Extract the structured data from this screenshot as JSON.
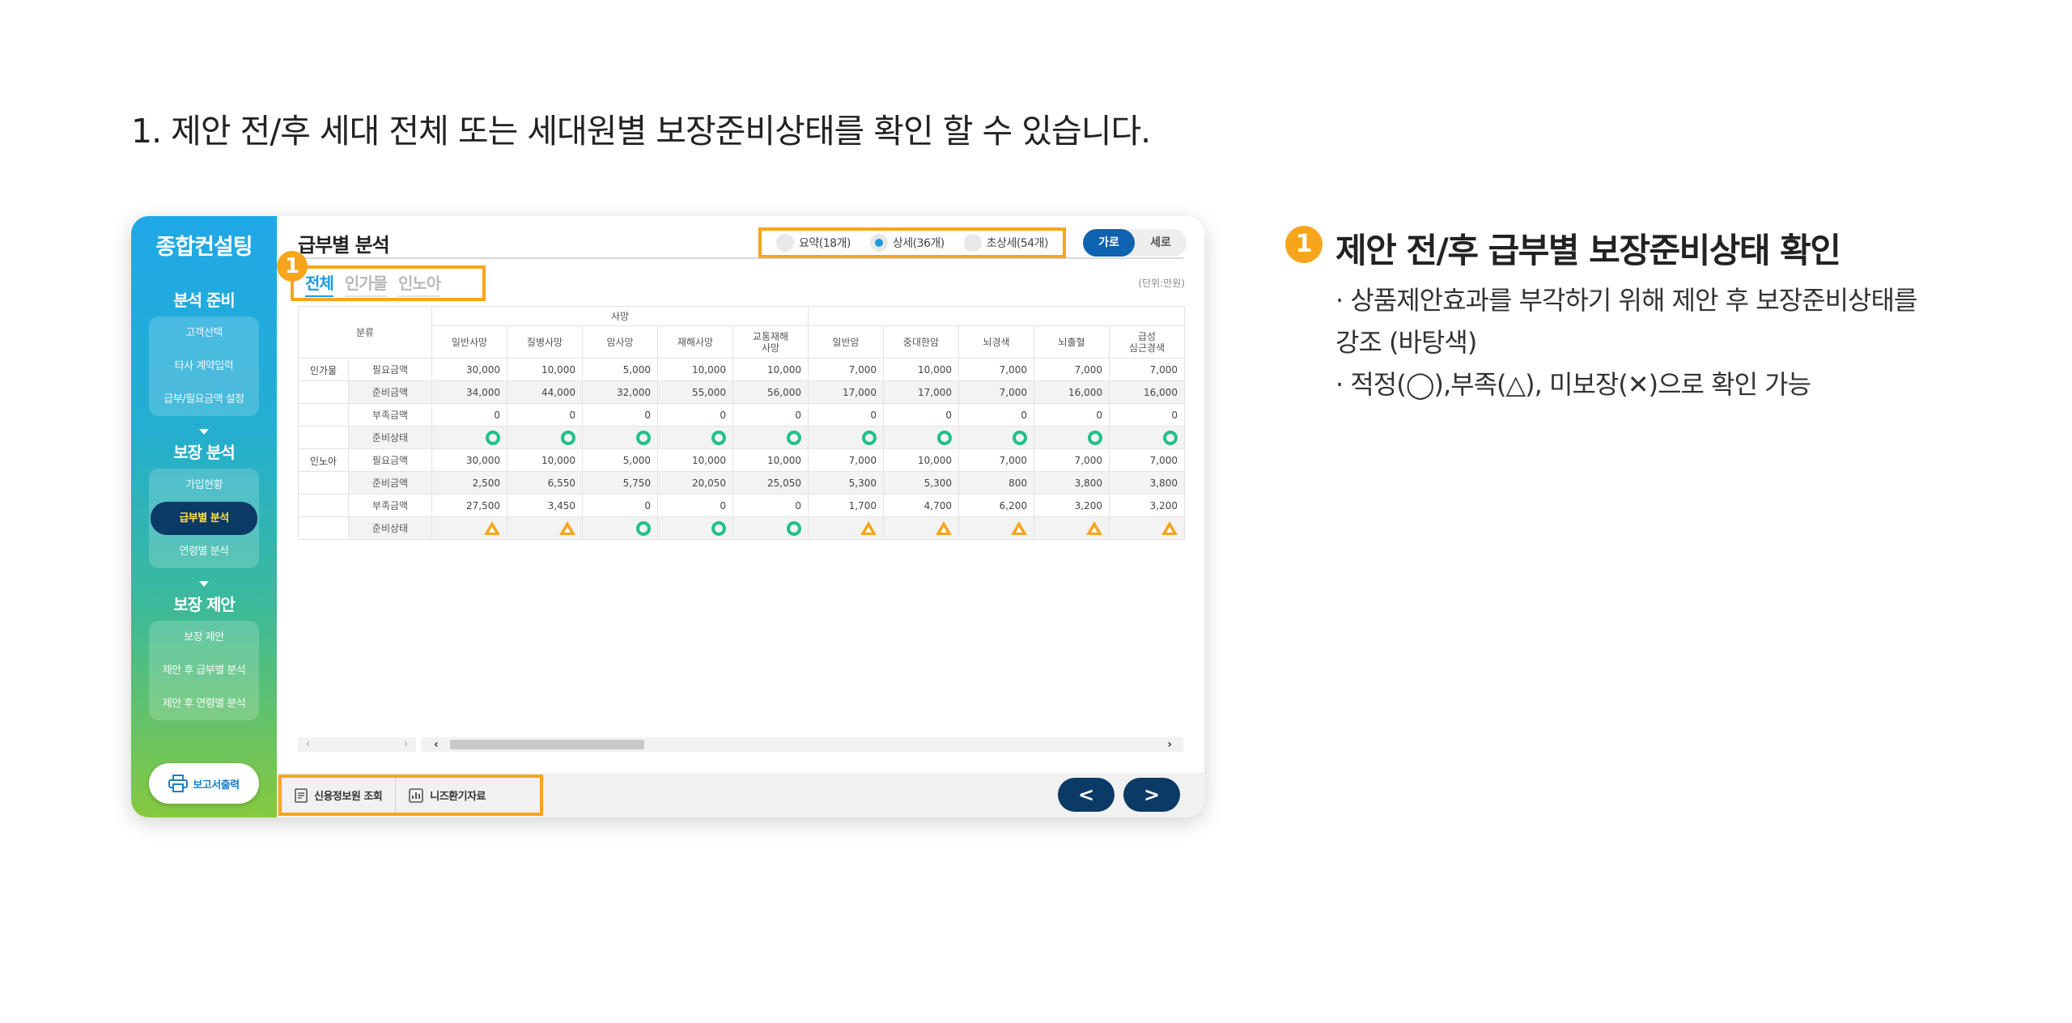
{
  "heading": "1. 제안 전/후  세대 전체 또는 세대원별 보장준비상태를 확인 할 수 있습니다.",
  "sidebar": {
    "brand": "종합컨설팅",
    "sections": [
      {
        "title": "분석 준비",
        "items": [
          "고객선택",
          "타사 계약입력",
          "급부/필요금액 설정"
        ]
      },
      {
        "title": "보장 분석",
        "items": [
          "가입현황",
          "급부별 분석",
          "연령별 분석"
        ],
        "active_index": 1
      },
      {
        "title": "보장 제안",
        "items": [
          "보장 제안",
          "제안 후 급부별 분석",
          "제안 후 연령별 분석"
        ]
      }
    ],
    "print_label": "보고서출력"
  },
  "content": {
    "title": "급부별 분석",
    "view_options": [
      {
        "label": "요약(18개)",
        "selected": false
      },
      {
        "label": "상세(36개)",
        "selected": true
      },
      {
        "label": "초상세(54개)",
        "selected": false
      }
    ],
    "orientation": [
      {
        "label": "가로",
        "selected": true
      },
      {
        "label": "세로",
        "selected": false
      }
    ],
    "tabs": [
      {
        "label": "전체",
        "selected": true
      },
      {
        "label": "인가물",
        "selected": false
      },
      {
        "label": "인노아",
        "selected": false
      }
    ],
    "badge_number": "1",
    "unit": "(단위:만원)"
  },
  "table": {
    "category_header": "분류",
    "group_header": "사망",
    "columns": [
      "일반사망",
      "질병사망",
      "암사망",
      "재해사망",
      "교통재해\n사망",
      "일반암",
      "중대한암",
      "뇌경색",
      "뇌출혈",
      "급성\n심근경색"
    ],
    "rows": [
      {
        "group": "인가물",
        "label": "필요금액",
        "values": [
          "30,000",
          "10,000",
          "5,000",
          "10,000",
          "10,000",
          "7,000",
          "10,000",
          "7,000",
          "7,000",
          "7,000"
        ]
      },
      {
        "group": "",
        "label": "준비금액",
        "values": [
          "34,000",
          "44,000",
          "32,000",
          "55,000",
          "56,000",
          "17,000",
          "17,000",
          "7,000",
          "16,000",
          "16,000"
        ]
      },
      {
        "group": "",
        "label": "부족금액",
        "values": [
          "0",
          "0",
          "0",
          "0",
          "0",
          "0",
          "0",
          "0",
          "0",
          "0"
        ]
      },
      {
        "group": "",
        "label": "준비상태",
        "status": [
          "ok",
          "ok",
          "ok",
          "ok",
          "ok",
          "ok",
          "ok",
          "ok",
          "ok",
          "ok"
        ]
      },
      {
        "group": "인노아",
        "label": "필요금액",
        "values": [
          "30,000",
          "10,000",
          "5,000",
          "10,000",
          "10,000",
          "7,000",
          "10,000",
          "7,000",
          "7,000",
          "7,000"
        ]
      },
      {
        "group": "",
        "label": "준비금액",
        "values": [
          "2,500",
          "6,550",
          "5,750",
          "20,050",
          "25,050",
          "5,300",
          "5,300",
          "800",
          "3,800",
          "3,800"
        ]
      },
      {
        "group": "",
        "label": "부족금액",
        "values": [
          "27,500",
          "3,450",
          "0",
          "0",
          "0",
          "1,700",
          "4,700",
          "6,200",
          "3,200",
          "3,200"
        ]
      },
      {
        "group": "",
        "label": "준비상태",
        "status": [
          "warn",
          "warn",
          "ok",
          "ok",
          "ok",
          "warn",
          "warn",
          "warn",
          "warn",
          "warn"
        ]
      }
    ]
  },
  "footer": {
    "tools": [
      "신용정보원 조회",
      "니즈환기자료"
    ],
    "prev": "<",
    "next": ">"
  },
  "description": {
    "badge_number": "1",
    "title": "제안 전/후 급부별 보장준비상태 확인",
    "lines": [
      "· 상품제안효과를 부각하기 위해 제안 후 보장준비상태를",
      "  강조 (바탕색)",
      "· 적정(◯),부족(△), 미보장(✕)으로 확인 가능"
    ]
  },
  "colors": {
    "accent_orange": "#f7a51c",
    "primary_blue": "#1e9ae0",
    "navy": "#0b3a66",
    "ok_green": "#22c08a"
  }
}
